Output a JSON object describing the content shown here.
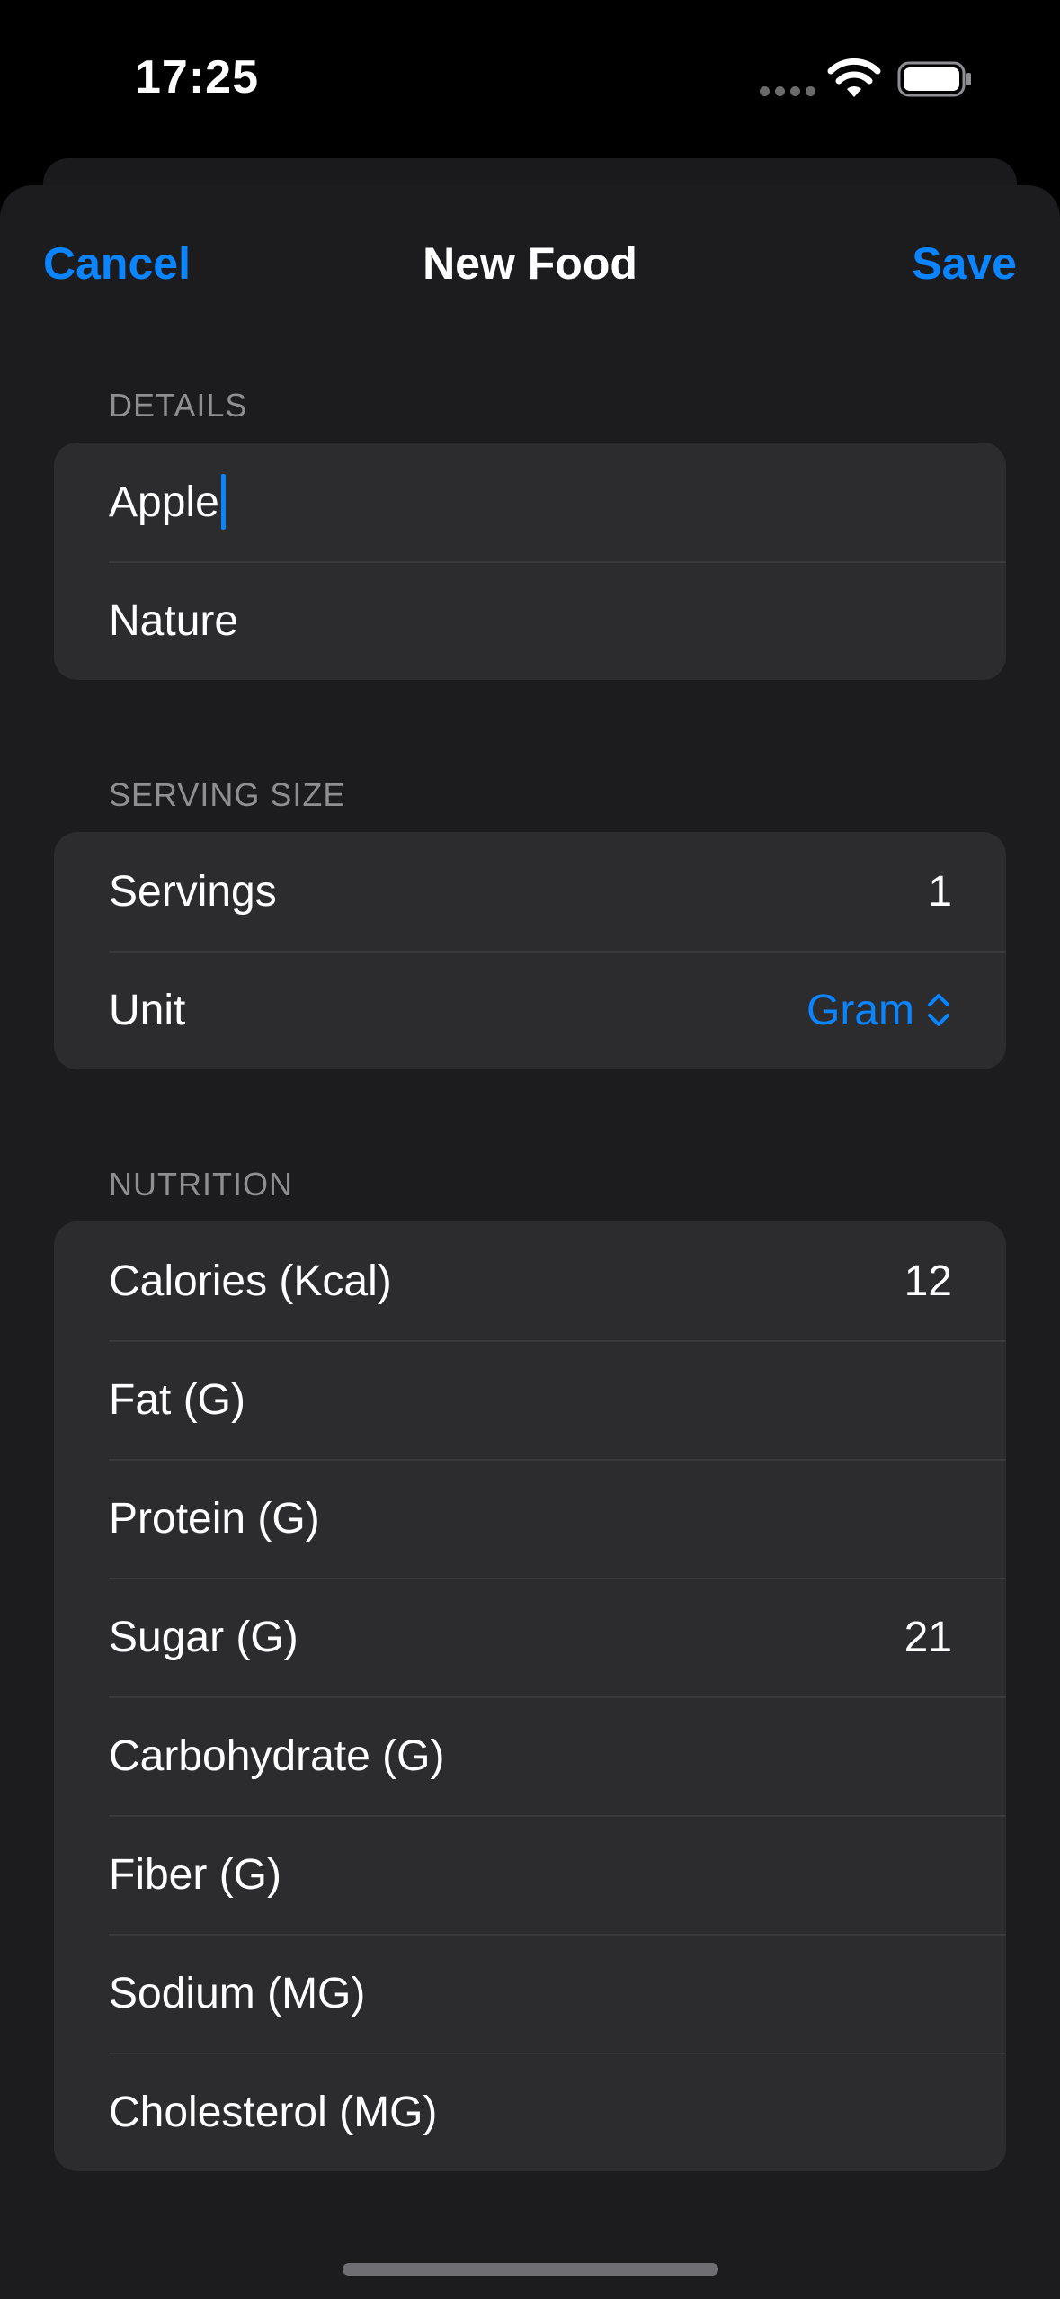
{
  "status_bar": {
    "time": "17:25",
    "icons": [
      "cellular-signal-icon",
      "wifi-icon",
      "battery-icon"
    ]
  },
  "nav": {
    "cancel_label": "Cancel",
    "title": "New Food",
    "save_label": "Save"
  },
  "details": {
    "header": "DETAILS",
    "name_value": "Apple",
    "brand_value": "Nature"
  },
  "serving": {
    "header": "SERVING SIZE",
    "servings_label": "Servings",
    "servings_value": "1",
    "unit_label": "Unit",
    "unit_value": "Gram",
    "unit_icon": "chevron-up-down-icon"
  },
  "nutrition": {
    "header": "NUTRITION",
    "rows": [
      {
        "label": "Calories (Kcal)",
        "value": "12"
      },
      {
        "label": "Fat (G)",
        "value": ""
      },
      {
        "label": "Protein (G)",
        "value": ""
      },
      {
        "label": "Sugar (G)",
        "value": "21"
      },
      {
        "label": "Carbohydrate (G)",
        "value": ""
      },
      {
        "label": "Fiber (G)",
        "value": ""
      },
      {
        "label": "Sodium (MG)",
        "value": ""
      },
      {
        "label": "Cholesterol (MG)",
        "value": ""
      }
    ]
  },
  "colors": {
    "accent": "#0a84ff",
    "background": "#1c1c1e",
    "cell": "#2c2c2e",
    "separator": "#3a3a3c",
    "secondary_text": "#8e8e93"
  }
}
